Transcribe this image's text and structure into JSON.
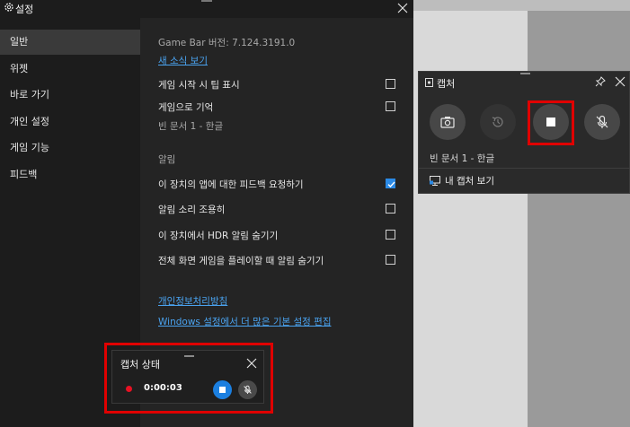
{
  "settings": {
    "title": "설정",
    "nav": [
      {
        "label": "일반"
      },
      {
        "label": "위젯"
      },
      {
        "label": "바로 가기"
      },
      {
        "label": "개인 설정"
      },
      {
        "label": "게임 기능"
      },
      {
        "label": "피드백"
      }
    ],
    "version": "Game Bar 버전: 7.124.3191.0",
    "whats_new_link": "새 소식 보기",
    "options": {
      "tips_label": "게임 시작 시 팁 표시",
      "remember_label": "게임으로 기억",
      "remember_sub": "빈 문서 1 - 한글",
      "notifications_header": "알림",
      "feedback_label": "이 장치의 앱에 대한 피드백 요청하기",
      "mute_label": "알림 소리 조용히",
      "hdr_label": "이 장치에서 HDR 알림 숨기기",
      "fullscreen_label": "전체 화면 게임을 플레이할 때 알림 숨기기"
    },
    "privacy_link": "개인정보처리방침",
    "windows_settings_link": "Windows 설정에서 더 많은 기본 설정 편집"
  },
  "capture": {
    "title": "캡처",
    "document": "빈 문서 1 - 한글",
    "gallery_label": "내 캡처 보기"
  },
  "status": {
    "title": "캡처 상태",
    "timer": "0:00:03"
  },
  "colors": {
    "accent": "#2b8ae6",
    "highlight": "#e00000",
    "record": "#e81123"
  }
}
